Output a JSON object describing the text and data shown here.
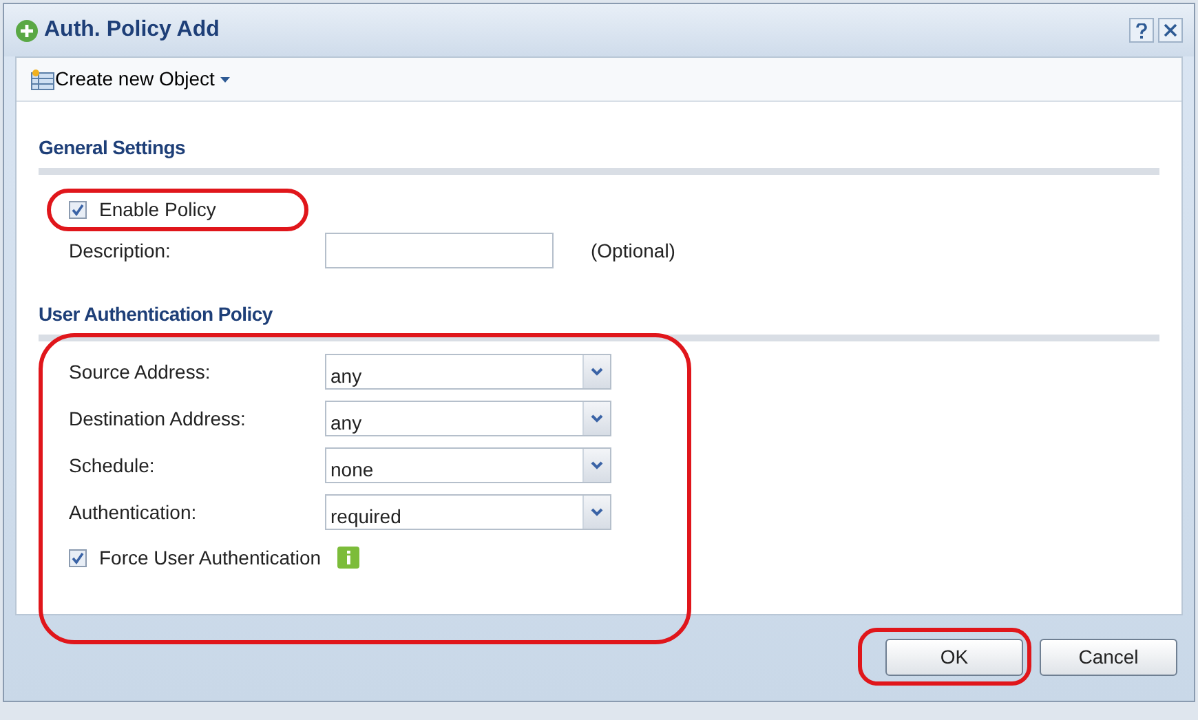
{
  "dialog": {
    "title": "Auth. Policy Add"
  },
  "toolbar": {
    "create_button": "Create new Object"
  },
  "general_settings": {
    "heading": "General Settings",
    "enable_policy": {
      "label": "Enable Policy",
      "checked": true,
      "highlighted": true
    },
    "description": {
      "label": "Description:",
      "hint": "(Optional)"
    }
  },
  "user_authentication_policy": {
    "heading": "User Authentication Policy",
    "highlighted": true,
    "fields": [
      {
        "label": "Source Address:",
        "value": "any"
      },
      {
        "label": "Destination Address:",
        "value": "any"
      },
      {
        "label": "Schedule:",
        "value": "none"
      },
      {
        "label": "Authentication:",
        "value": "required"
      }
    ],
    "force_user_authentication": {
      "label": "Force User Authentication",
      "checked": true
    }
  },
  "buttons": [
    {
      "label": "OK",
      "highlighted": true
    },
    {
      "label": "Cancel",
      "highlighted": false
    }
  ]
}
